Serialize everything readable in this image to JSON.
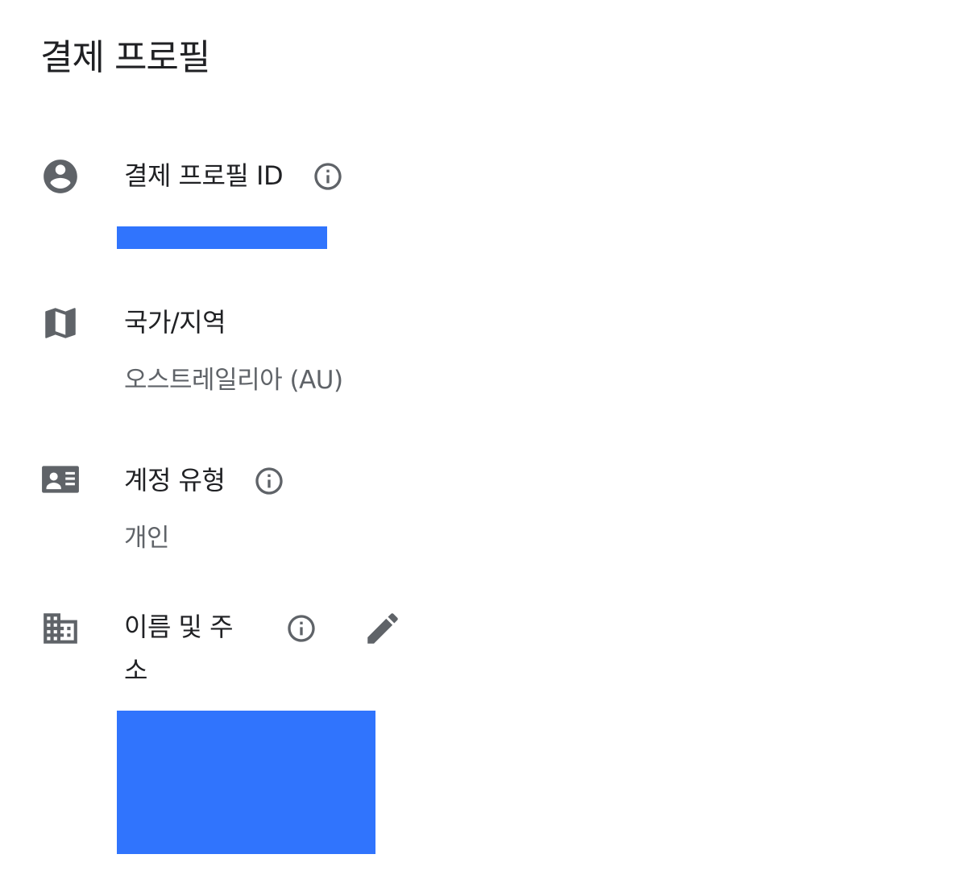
{
  "page": {
    "title": "결제 프로필"
  },
  "profile_id": {
    "icon": "account-circle-icon",
    "label": "결제 프로필 ID",
    "value_redacted": true
  },
  "country": {
    "icon": "map-icon",
    "label": "국가/지역",
    "value": "오스트레일리아 (AU)"
  },
  "account_type": {
    "icon": "contact-card-icon",
    "label": "계정 유형",
    "value": "개인"
  },
  "name_address": {
    "icon": "business-building-icon",
    "label_line1": "이름 및 주",
    "label_line2": "소",
    "value_redacted": true
  },
  "colors": {
    "icon_dark": "#5f6368",
    "text_primary": "#202124",
    "text_secondary": "#5f6368",
    "redaction": "#3074fd"
  }
}
